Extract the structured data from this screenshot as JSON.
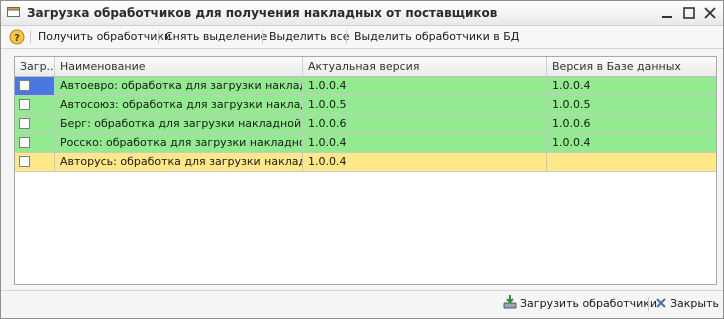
{
  "window": {
    "title": "Загрузка обработчиков для получения накладных от поставщиков"
  },
  "toolbar": {
    "get_handlers": "Получить обработчики",
    "clear_selection": "Снять выделение",
    "select_all": "Выделить все",
    "select_in_db": "Выделить обработчики в БД"
  },
  "table": {
    "columns": [
      "Загр...",
      "Наименование",
      "Актуальная версия",
      "Версия в Базе данных"
    ],
    "rows": [
      {
        "checked": false,
        "name": "Автоевро: обработка для загрузки накладной",
        "actual_version": "1.0.0.4",
        "db_version": "1.0.0.4",
        "status": "green"
      },
      {
        "checked": false,
        "name": "Автосоюз: обработка для загрузки накладной",
        "actual_version": "1.0.0.5",
        "db_version": "1.0.0.5",
        "status": "green"
      },
      {
        "checked": false,
        "name": "Берг: обработка для загрузки накладной",
        "actual_version": "1.0.0.6",
        "db_version": "1.0.0.6",
        "status": "green"
      },
      {
        "checked": false,
        "name": "Росско: обработка для загрузки накладной",
        "actual_version": "1.0.0.4",
        "db_version": "1.0.0.4",
        "status": "green"
      },
      {
        "checked": false,
        "name": "Авторусь: обработка для загрузки накладной",
        "actual_version": "1.0.0.4",
        "db_version": "",
        "status": "yellow"
      }
    ]
  },
  "footer": {
    "load_handlers": "Загрузить обработчики",
    "close": "Закрыть"
  },
  "colors": {
    "row_in_db": "#93ea90",
    "row_not_in_db": "#fde88a",
    "row_selected_marker": "#4a78e0"
  },
  "icons": [
    "app-icon",
    "minimize-icon",
    "maximize-icon",
    "close-icon",
    "help-icon",
    "load-icon",
    "close-x-icon"
  ]
}
